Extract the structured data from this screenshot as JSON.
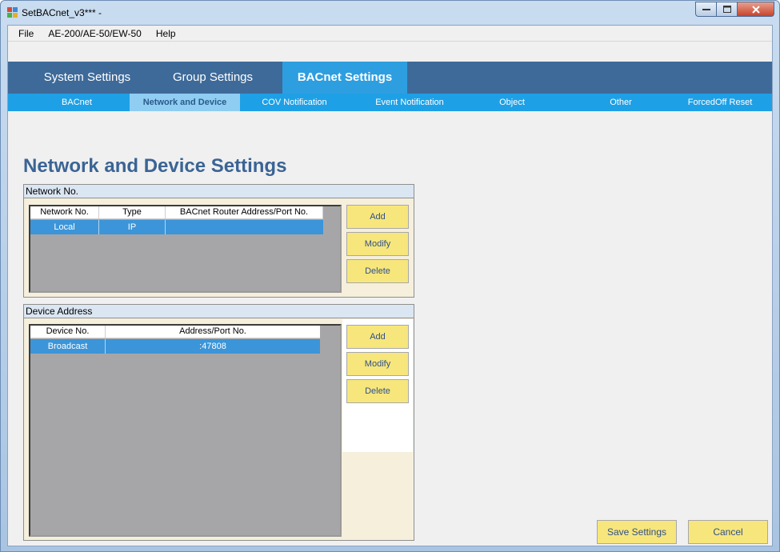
{
  "window": {
    "title": "SetBACnet_v3*** -",
    "minimize_label": "▭",
    "maximize_label": "□",
    "close_label": "✕"
  },
  "menu": [
    {
      "label": "File"
    },
    {
      "label": "AE-200/AE-50/EW-50"
    },
    {
      "label": "Help"
    }
  ],
  "main_tabs": [
    {
      "label": "System Settings",
      "active": false
    },
    {
      "label": "Group Settings",
      "active": false
    },
    {
      "label": "BACnet Settings",
      "active": true
    }
  ],
  "sub_tabs": [
    {
      "label": "BACnet",
      "active": false
    },
    {
      "label": "Network and Device",
      "active": true
    },
    {
      "label": "COV Notification",
      "active": false
    },
    {
      "label": "Event Notification",
      "active": false
    },
    {
      "label": "Object",
      "active": false
    },
    {
      "label": "Other",
      "active": false
    },
    {
      "label": "ForcedOff Reset",
      "active": false
    }
  ],
  "page_title": "Network and Device Settings",
  "network_group": {
    "title": "Network No.",
    "columns": [
      "Network No.",
      "Type",
      "BACnet Router Address/Port No."
    ],
    "rows": [
      {
        "network_no": "Local",
        "type": "IP",
        "router": "",
        "selected": true
      }
    ],
    "buttons": {
      "add": "Add",
      "modify": "Modify",
      "delete": "Delete"
    }
  },
  "device_group": {
    "title": "Device Address",
    "columns": [
      "Device No.",
      "Address/Port No."
    ],
    "rows": [
      {
        "device_no": "Broadcast",
        "address": ":47808",
        "selected": true
      }
    ],
    "buttons": {
      "add": "Add",
      "modify": "Modify",
      "delete": "Delete"
    }
  },
  "footer": {
    "save_label": "Save Settings",
    "cancel_label": "Cancel"
  },
  "colors": {
    "main_tab_bar": "#3e6a99",
    "main_tab_active": "#2d9ee0",
    "sub_tab_bar": "#1ea0e6",
    "sub_tab_active": "#8fcdf2",
    "selected_row": "#3c95d8",
    "button_fill": "#f7e67c",
    "title_color": "#3a6494"
  },
  "icons": {
    "app": "app-icon",
    "minimize": "minimize-icon",
    "maximize": "maximize-icon",
    "close": "close-icon"
  }
}
